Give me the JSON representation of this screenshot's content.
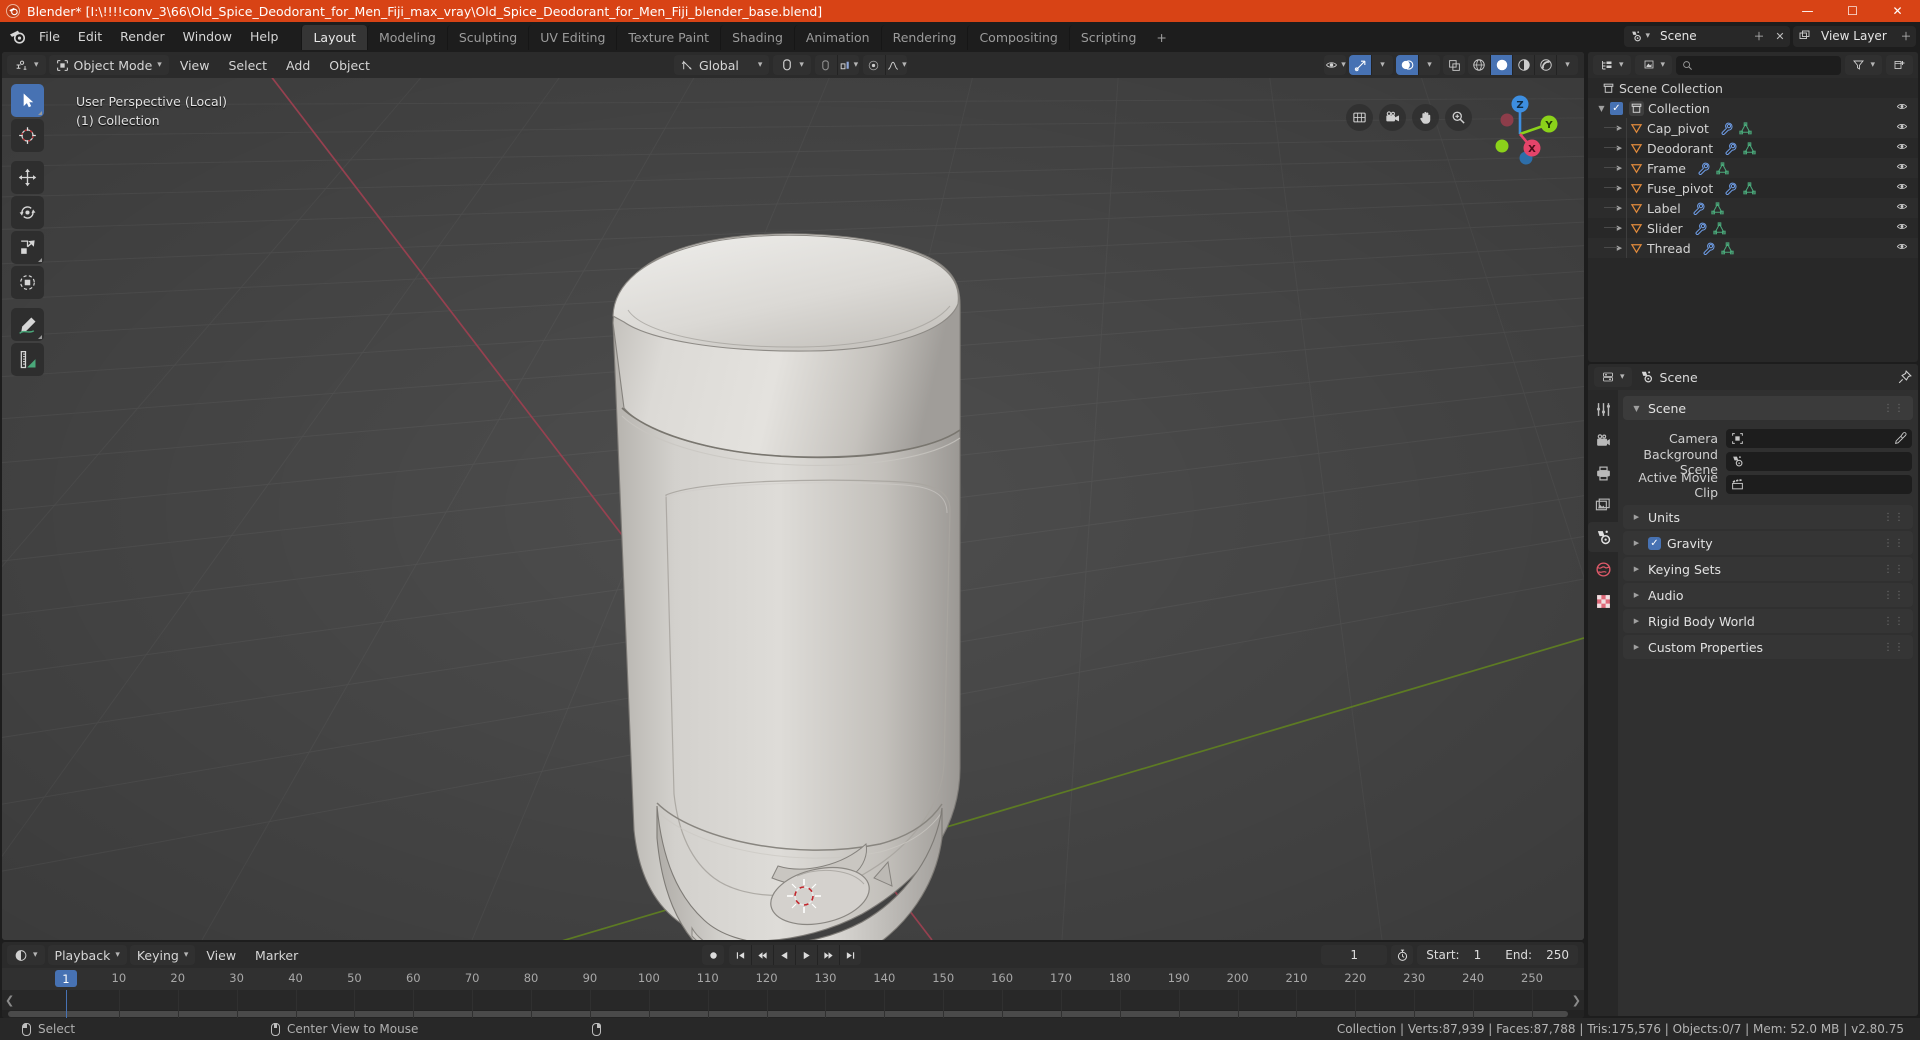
{
  "window": {
    "title": "Blender* [I:\\!!!!conv_3\\66\\Old_Spice_Deodorant_for_Men_Fiji_max_vray\\Old_Spice_Deodorant_for_Men_Fiji_blender_base.blend]",
    "app_icon": "blender-icon",
    "minimize": "—",
    "maximize": "☐",
    "close": "✕",
    "accent": "#d84315"
  },
  "topbar": {
    "menus": [
      "File",
      "Edit",
      "Render",
      "Window",
      "Help"
    ],
    "workspaces": [
      {
        "label": "Layout",
        "active": true
      },
      {
        "label": "Modeling",
        "active": false
      },
      {
        "label": "Sculpting",
        "active": false
      },
      {
        "label": "UV Editing",
        "active": false
      },
      {
        "label": "Texture Paint",
        "active": false
      },
      {
        "label": "Shading",
        "active": false
      },
      {
        "label": "Animation",
        "active": false
      },
      {
        "label": "Rendering",
        "active": false
      },
      {
        "label": "Compositing",
        "active": false
      },
      {
        "label": "Scripting",
        "active": false
      }
    ],
    "add_workspace": "+",
    "scene_name": "Scene",
    "view_layer_name": "View Layer",
    "scene_icon": "scene-icon",
    "viewlayer_icon": "view-layer-icon",
    "new_icon": "＋",
    "unlink_icon": "✕",
    "browse_icon": "⌄"
  },
  "viewport": {
    "mode": "Object Mode",
    "mode_icon": "object-mode-icon",
    "editor_type_icon": "editor-type-3dview-icon",
    "menus": [
      "View",
      "Select",
      "Add",
      "Object"
    ],
    "transform_orientation": "Global",
    "snap_icon": "magnet-icon",
    "snap_target_icon": "snap-increment-icon",
    "pivot_icon": "pivot-median-icon",
    "proportional_icon": "proportional-falloff-icon",
    "overlay_text_line1": "User Perspective (Local)",
    "overlay_text_line2": "(1) Collection",
    "tools": [
      {
        "name": "tweak-tool",
        "active": true
      },
      {
        "name": "cursor-tool",
        "active": false
      },
      {
        "name": "move-tool",
        "active": false
      },
      {
        "name": "rotate-tool",
        "active": false
      },
      {
        "name": "scale-tool",
        "active": false
      },
      {
        "name": "transform-tool",
        "active": false
      },
      {
        "name": "annotate-tool",
        "active": false
      },
      {
        "name": "measure-tool",
        "active": false
      }
    ],
    "nav_buttons": [
      "grid-ortho-icon",
      "camera-view-icon",
      "hand-pan-icon",
      "zoom-icon"
    ],
    "gizmo_axes": {
      "x": "X",
      "y": "Y",
      "z": "Z",
      "x_color": "#e5446a",
      "y_color": "#8bd21a",
      "z_color": "#3d8ee0"
    },
    "header_right_toggles": [
      "visibility-icon",
      "gizmo-icon",
      "overlays-icon",
      "xray-icon",
      "shading-wireframe-icon",
      "shading-solid-icon",
      "shading-material-icon",
      "shading-rendered-icon"
    ]
  },
  "outliner": {
    "display_mode_icon": "outliner-display-icon",
    "filter_data_icon": "outliner-data-icon",
    "search_placeholder": "",
    "search_icon": "search-icon",
    "filter_icon": "filter-icon",
    "new_collection_icon": "new-collection-icon",
    "root": "Scene Collection",
    "collection": "Collection",
    "items": [
      {
        "label": "Cap_pivot"
      },
      {
        "label": "Deodorant"
      },
      {
        "label": "Frame"
      },
      {
        "label": "Fuse_pivot"
      },
      {
        "label": "Label"
      },
      {
        "label": "Slider"
      },
      {
        "label": "Thread"
      }
    ],
    "colors": {
      "object": "#e08a3c",
      "mesh": "#4aa87a",
      "modifier": "#6f9ee8"
    }
  },
  "properties": {
    "editor_icon": "properties-editor-icon",
    "breadcrumb": "Scene",
    "breadcrumb_icon": "scene-icon",
    "pin_icon": "pin-icon",
    "tabs": [
      {
        "name": "tool-tab",
        "active": false
      },
      {
        "name": "render-tab",
        "active": false
      },
      {
        "name": "output-tab",
        "active": false
      },
      {
        "name": "view-layer-tab",
        "active": false
      },
      {
        "name": "scene-tab",
        "active": true
      },
      {
        "name": "world-tab",
        "active": false
      },
      {
        "name": "texture-tab",
        "active": false
      }
    ],
    "panel_title": "Scene",
    "rows": [
      {
        "label": "Camera",
        "value": "",
        "icon": "camera-field-icon",
        "eyedropper": true
      },
      {
        "label": "Background Scene",
        "value": "",
        "icon": "scene-field-icon",
        "eyedropper": false
      },
      {
        "label": "Active Movie Clip",
        "value": "",
        "icon": "clip-field-icon",
        "eyedropper": false
      }
    ],
    "sections": [
      {
        "label": "Units",
        "checkbox": null
      },
      {
        "label": "Gravity",
        "checkbox": true
      },
      {
        "label": "Keying Sets",
        "checkbox": null
      },
      {
        "label": "Audio",
        "checkbox": null
      },
      {
        "label": "Rigid Body World",
        "checkbox": null
      },
      {
        "label": "Custom Properties",
        "checkbox": null
      }
    ]
  },
  "timeline": {
    "editor_icon": "timeline-editor-icon",
    "menus": [
      "Playback",
      "Keying",
      "View",
      "Marker"
    ],
    "record_icon": "●",
    "transport": [
      "jump-start-icon",
      "prev-keyframe-icon",
      "play-reverse-icon",
      "play-icon",
      "next-keyframe-icon",
      "jump-end-icon"
    ],
    "current_frame": "1",
    "autokey_icon": "auto-keying-icon",
    "start_label": "Start:",
    "start_value": "1",
    "end_label": "End:",
    "end_value": "250",
    "ticks": [
      10,
      20,
      30,
      40,
      50,
      60,
      70,
      80,
      90,
      100,
      110,
      120,
      130,
      140,
      150,
      160,
      170,
      180,
      190,
      200,
      210,
      220,
      230,
      240,
      250
    ],
    "playhead_frame": "1"
  },
  "statusbar": {
    "left_items": [
      {
        "mouse": "left",
        "label": "Select"
      },
      {
        "mouse": "middle",
        "label": "Center View to Mouse"
      },
      {
        "mouse": "right",
        "label": ""
      }
    ],
    "stats": "Collection | Verts:87,939 | Faces:87,788 | Tris:175,576 | Objects:0/7 | Mem: 52.0 MB | v2.80.75"
  }
}
